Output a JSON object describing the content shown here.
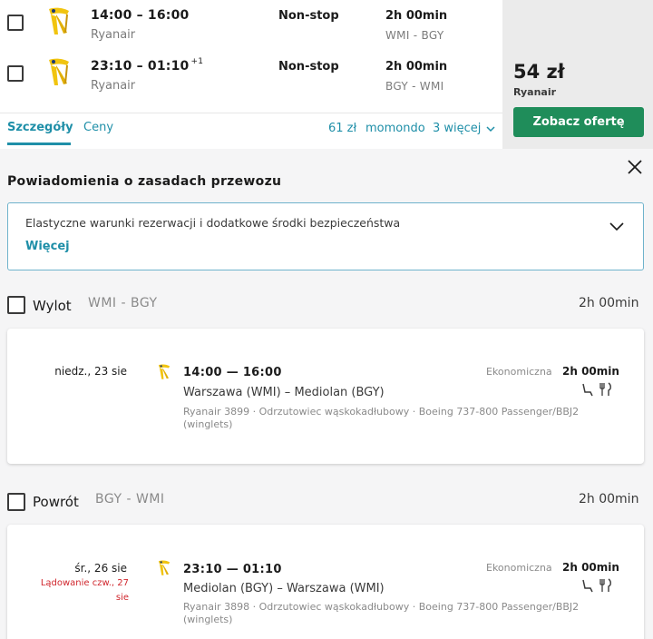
{
  "flights": [
    {
      "depart_arrive": "14:00 – 16:00",
      "plus_days": "",
      "airline": "Ryanair",
      "stops": "Non-stop",
      "duration": "2h 00min",
      "route": "WMI - BGY"
    },
    {
      "depart_arrive": "23:10 – 01:10",
      "plus_days": "+1",
      "airline": "Ryanair",
      "stops": "Non-stop",
      "duration": "2h 00min",
      "route": "BGY - WMI"
    }
  ],
  "price": {
    "amount": "54 zł",
    "provider": "Ryanair",
    "button": "Zobacz ofertę"
  },
  "tabs": {
    "details": "Szczegóły",
    "prices": "Ceny"
  },
  "other_offers": {
    "price": "61 zł",
    "provider": "momondo",
    "more": "3 więcej"
  },
  "rules": {
    "title": "Powiadomienia o zasadach przewozu",
    "notice_text": "Elastyczne warunki rezerwacji i dodatkowe środki bezpieczeństwa",
    "notice_more": "Więcej"
  },
  "legs": [
    {
      "label": "Wylot",
      "route": "WMI - BGY",
      "duration": "2h 00min",
      "segment": {
        "date": "niedz., 23 sie",
        "arrival_note": "",
        "times": "14:00 — 16:00",
        "cities": "Warszawa (WMI) – Mediolan (BGY)",
        "details": "Ryanair 3899 · Odrzutowiec wąskokadłubowy · Boeing 737-800 Passenger/BBJ2 (winglets)",
        "cabin": "Ekonomiczna",
        "duration": "2h 00min"
      }
    },
    {
      "label": "Powrót",
      "route": "BGY - WMI",
      "duration": "2h 00min",
      "segment": {
        "date": "śr., 26 sie",
        "arrival_note": "Lądowanie czw., 27 sie",
        "times": "23:10 — 01:10",
        "cities": "Mediolan (BGY) – Warszawa (WMI)",
        "details": "Ryanair 3898 · Odrzutowiec wąskokadłubowy · Boeing 737-800 Passenger/BBJ2 (winglets)",
        "cabin": "Ekonomiczna",
        "duration": "2h 00min"
      }
    }
  ],
  "colors": {
    "accent": "#1f8fa8",
    "cta": "#1f8d5a",
    "alert": "#d0262d",
    "ryanair_gold": "#f1c40f"
  }
}
